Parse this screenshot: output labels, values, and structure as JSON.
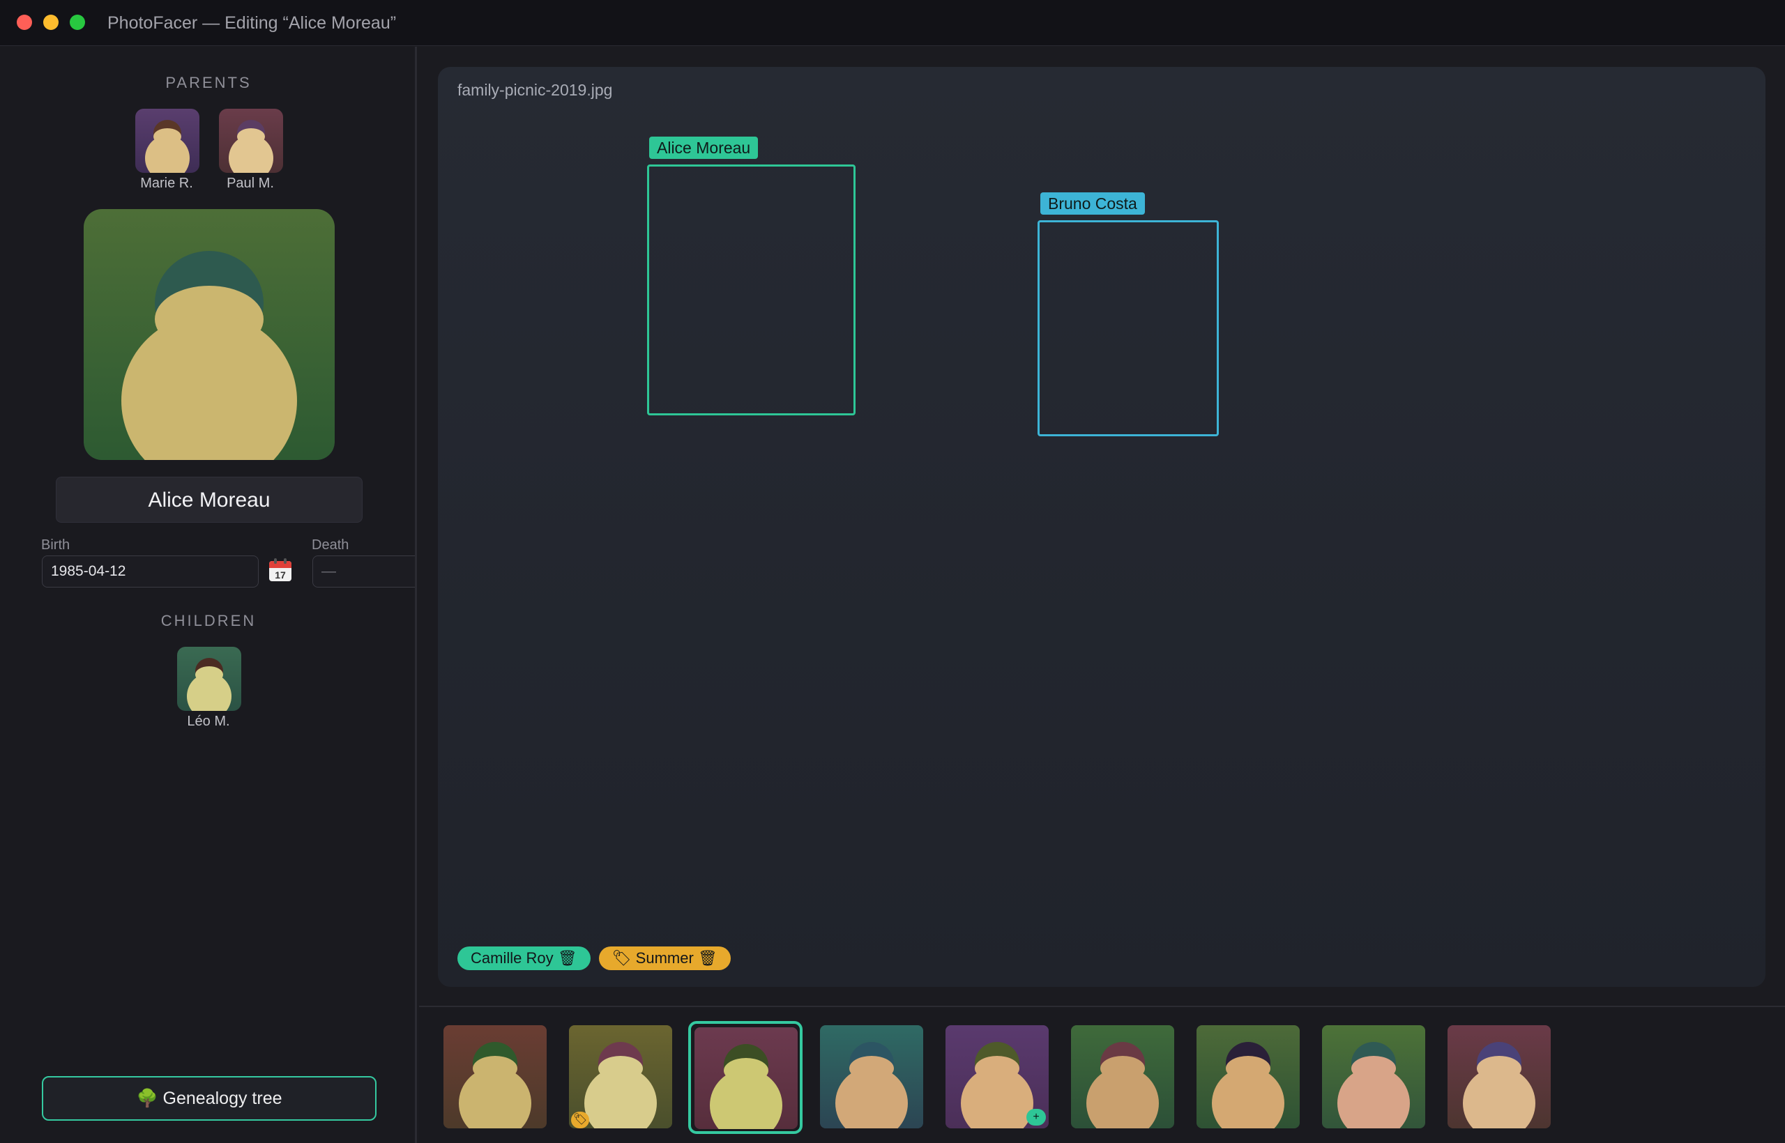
{
  "window": {
    "title": "PhotoFacer — Editing “Alice Moreau”"
  },
  "sidebar": {
    "parents_title": "PARENTS",
    "parents": [
      {
        "name": "Marie R."
      },
      {
        "name": "Paul M."
      }
    ],
    "person_name": "Alice Moreau",
    "birth_label": "Birth",
    "birth_value": "1985-04-12",
    "death_label": "Death",
    "death_placeholder": "—",
    "calendar_icon": "📅",
    "children_title": "CHILDREN",
    "children": [
      {
        "name": "Léo M."
      }
    ],
    "genealogy_button": "🌳 Genealogy tree"
  },
  "viewer": {
    "filename": "family-picnic-2019.jpg",
    "faces": [
      {
        "name": "Alice Moreau",
        "color": "#2ec696"
      },
      {
        "name": "Bruno Costa",
        "color": "#3db4d6"
      }
    ],
    "chips": [
      {
        "label": "Camille Roy 🗑",
        "kind": "person"
      },
      {
        "label": "🏷 Summer 🗑",
        "kind": "tag"
      }
    ]
  },
  "filmstrip": {
    "selected_index": 2,
    "badges": {
      "tag": "🏷",
      "add": "+"
    }
  },
  "colors": {
    "accent": "#35c9a0",
    "face_alice": "#2ec696",
    "face_bruno": "#3db4d6",
    "tag_amber": "#e7a92c"
  }
}
